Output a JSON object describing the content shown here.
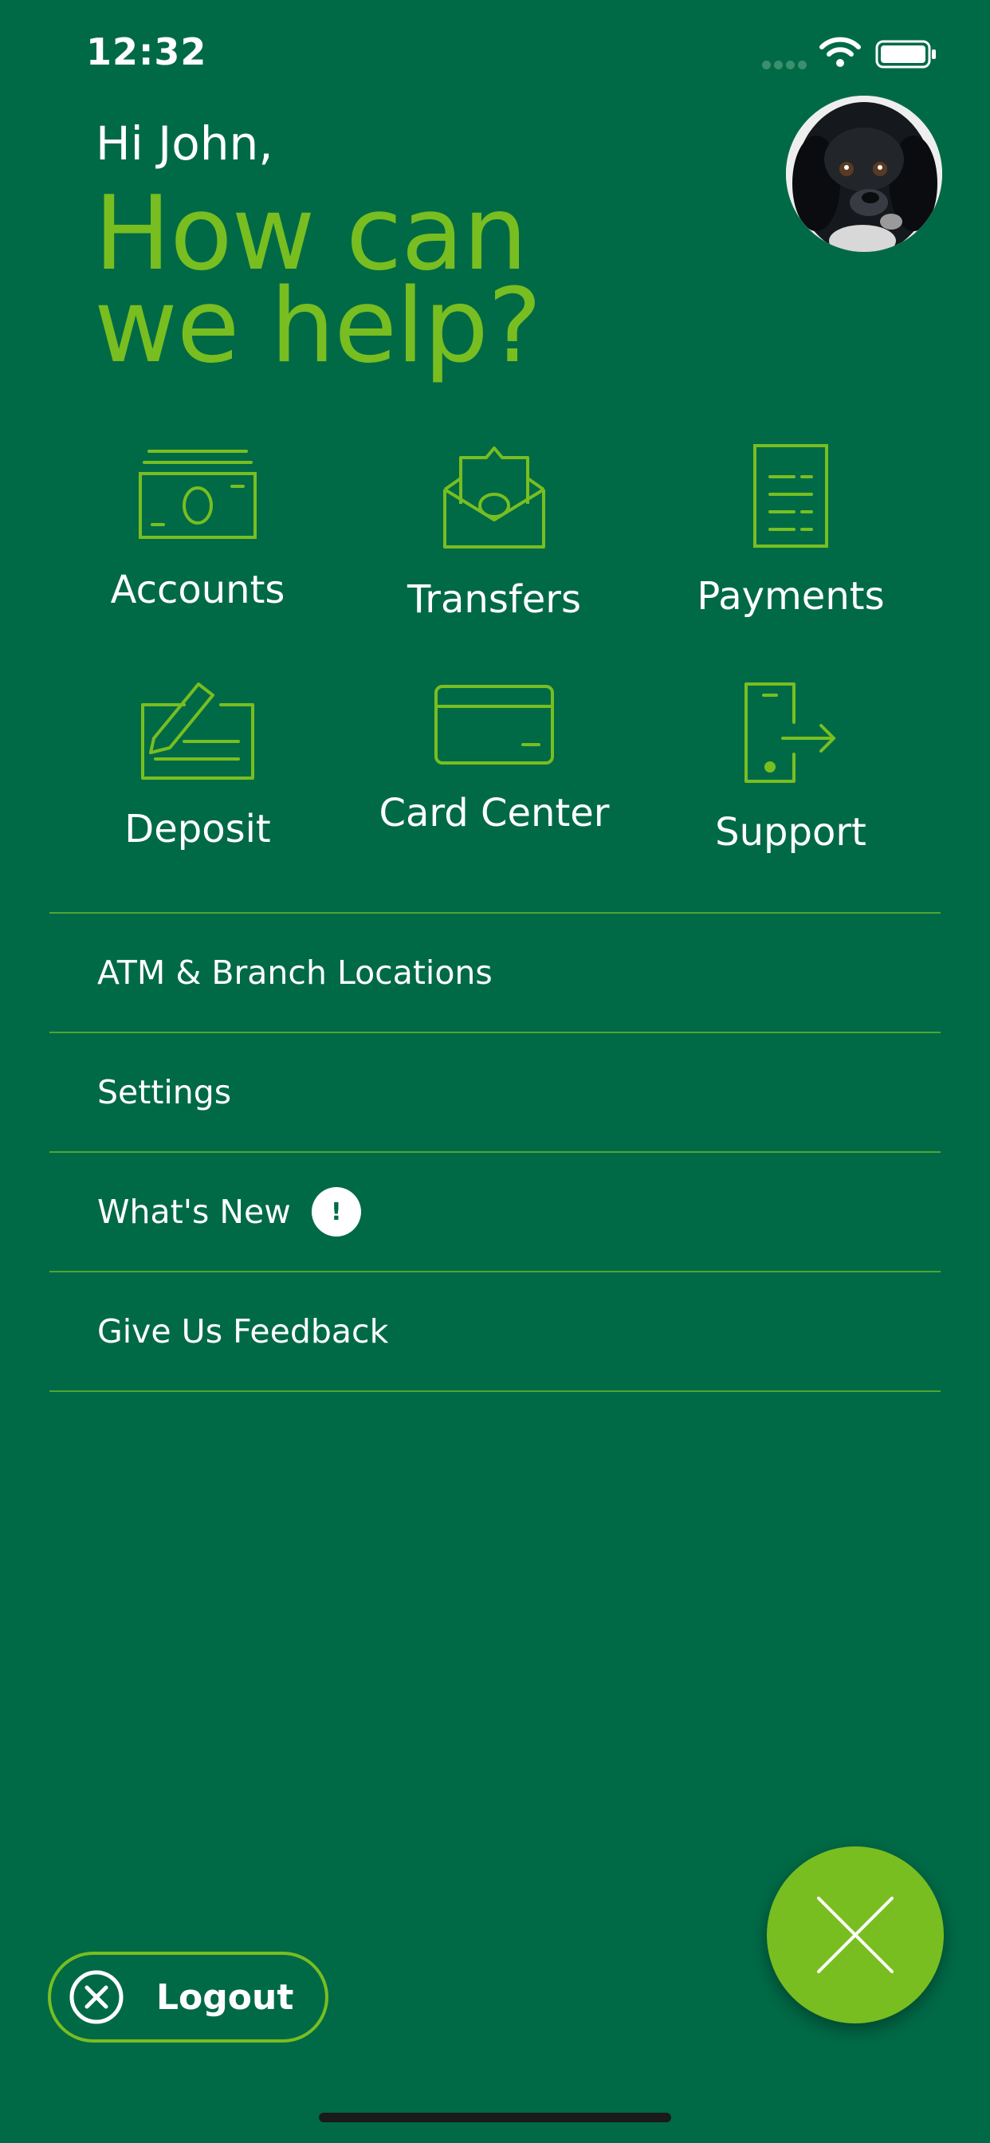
{
  "status_bar": {
    "time": "12:32"
  },
  "header": {
    "greeting": "Hi John,",
    "headline_line1": "How can",
    "headline_line2": "we help?"
  },
  "tiles": [
    {
      "label": "Accounts",
      "icon": "cash-icon"
    },
    {
      "label": "Transfers",
      "icon": "envelope-money-icon"
    },
    {
      "label": "Payments",
      "icon": "receipt-icon"
    },
    {
      "label": "Deposit",
      "icon": "check-pen-icon"
    },
    {
      "label": "Card Center",
      "icon": "credit-card-icon"
    },
    {
      "label": "Support",
      "icon": "phone-exit-icon"
    }
  ],
  "menu": {
    "items": [
      {
        "label": "ATM & Branch Locations"
      },
      {
        "label": "Settings"
      },
      {
        "label": "What's New",
        "badge": "!"
      },
      {
        "label": "Give Us Feedback"
      }
    ]
  },
  "logout": {
    "label": "Logout"
  },
  "colors": {
    "background": "#006a46",
    "accent": "#78be20",
    "text": "#ffffff"
  }
}
